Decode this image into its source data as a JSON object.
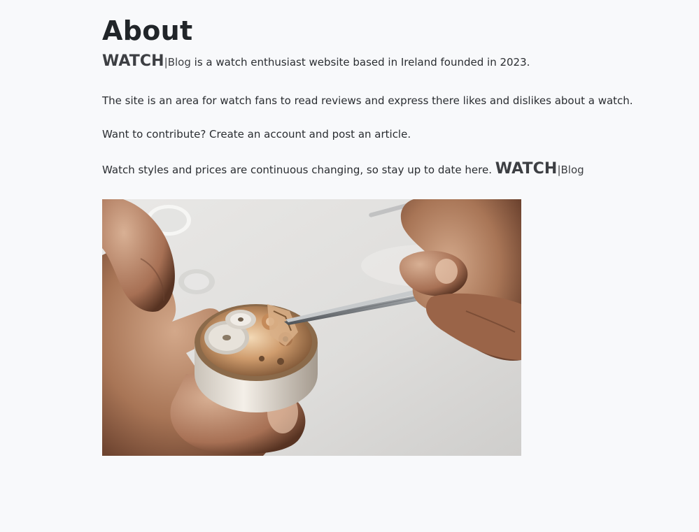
{
  "page": {
    "title": "About"
  },
  "brand": {
    "name": "WATCH",
    "suffix": "|Blog"
  },
  "paragraphs": {
    "intro_rest": " is a watch enthusiast website based in Ireland founded in 2023.",
    "site_area": "The site is an area for watch fans to read reviews and express there likes and dislikes about a watch.",
    "contribute": "Want to contribute? Create an account and post an article.",
    "stay_updated": "Watch styles and prices are continuous changing, so stay up to date here. "
  },
  "image": {
    "subject": "watchmaker-hands-repairing-watch-movement"
  }
}
